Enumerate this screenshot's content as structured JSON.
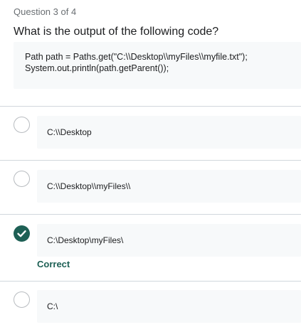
{
  "quiz": {
    "progress": "Question 3 of 4",
    "question": "What is the output of the following code?",
    "code_lines": [
      "Path path = Paths.get(\"C:\\\\Desktop\\\\myFiles\\\\myfile.txt\");",
      "System.out.println(path.getParent());"
    ],
    "answers": [
      {
        "label": "C:\\\\Desktop",
        "selected": false
      },
      {
        "label": "C:\\\\Desktop\\\\myFiles\\\\",
        "selected": false
      },
      {
        "label": "C:\\Desktop\\myFiles\\",
        "selected": true,
        "feedback": "Correct"
      },
      {
        "label": "C:\\",
        "selected": false
      }
    ]
  },
  "colors": {
    "correct": "#1e6055",
    "answer_bg": "#f7f9fa",
    "divider": "#d1d7dc"
  },
  "icons": {
    "selected_radio": "check-icon"
  }
}
